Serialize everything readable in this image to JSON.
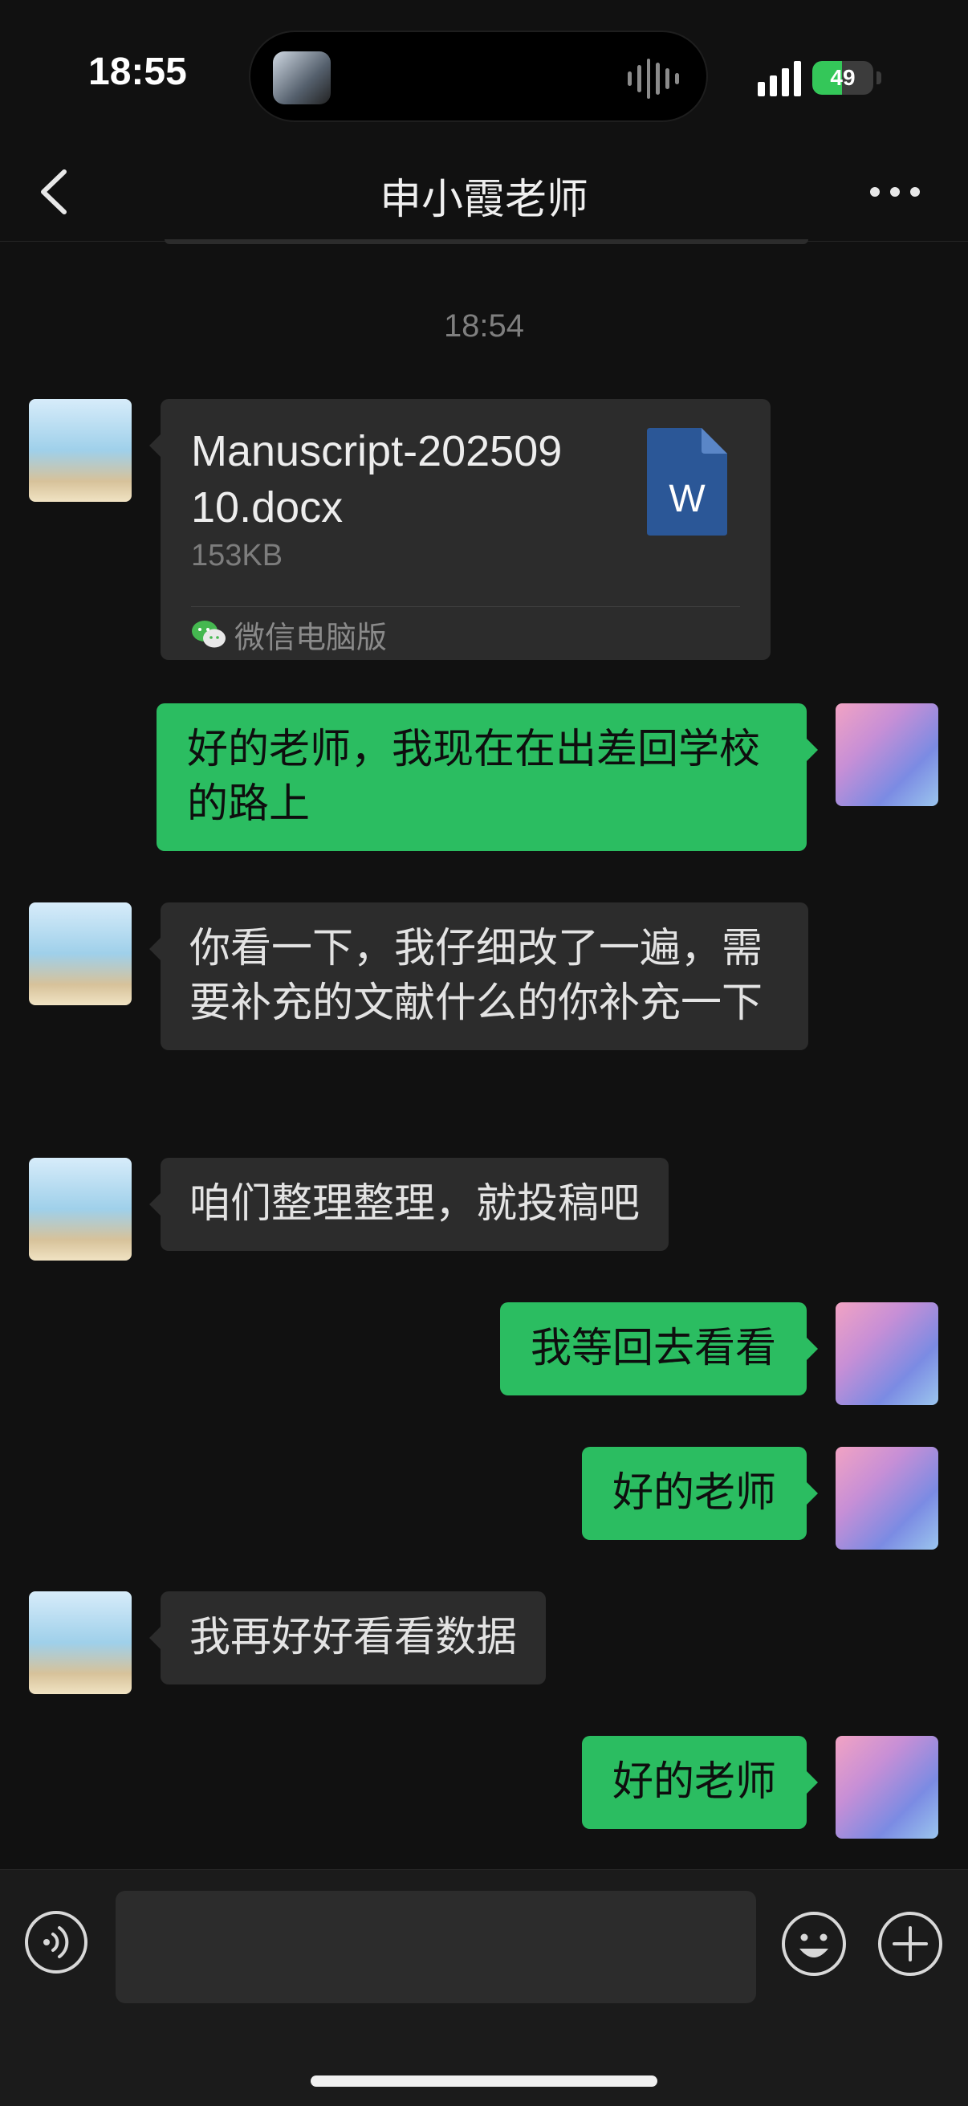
{
  "status_bar": {
    "time": "18:55",
    "battery_level": "49",
    "battery_percent": 49
  },
  "nav": {
    "title": "申小霞老师",
    "back_icon": "chevron-left-icon",
    "more_icon": "more-dots-icon"
  },
  "timestamp": "18:54",
  "file_message": {
    "file_name": "Manuscript-20250910.docx",
    "file_size": "153KB",
    "file_icon_letter": "W",
    "source": "微信电脑版"
  },
  "messages": [
    {
      "text": "好的老师，我现在在出差回学校的路上"
    },
    {
      "text": "你看一下，我仔细改了一遍，需要补充的文献什么的你补充一下"
    },
    {
      "text": "咱们整理整理，就投稿吧"
    },
    {
      "text": "我等回去看看"
    },
    {
      "text": "好的老师"
    },
    {
      "text": "我再好好看看数据"
    },
    {
      "text": "好的老师"
    }
  ],
  "input_bar": {
    "placeholder": "",
    "voice_icon": "voice-icon",
    "emoji_icon": "emoji-icon",
    "plus_icon": "plus-icon"
  },
  "colors": {
    "background": "#111111",
    "outgoing_bubble": "#2bbd61",
    "incoming_bubble": "#2c2c2c",
    "word_blue": "#2b5797"
  }
}
